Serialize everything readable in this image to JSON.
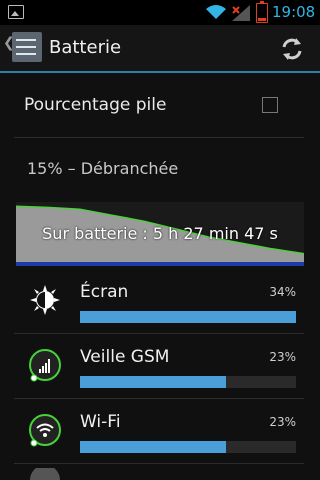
{
  "status_bar": {
    "time": "19:08"
  },
  "action_bar": {
    "title": "Batterie",
    "back_glyph": "❮"
  },
  "settings": {
    "percentage_label": "Pourcentage pile",
    "percentage_checked": false
  },
  "battery": {
    "status": "15% – Débranchée",
    "graph_label": "Sur batterie : 5 h 27 min 47 s",
    "graph_level": [
      0.93,
      0.91,
      0.88,
      0.78,
      0.68,
      0.55,
      0.42,
      0.32,
      0.22,
      0.14
    ]
  },
  "usage": [
    {
      "name": "Écran",
      "percent_label": "34%",
      "fraction": 1.0,
      "icon": "brightness-icon"
    },
    {
      "name": "Veille GSM",
      "percent_label": "23%",
      "fraction": 0.676,
      "icon": "cell-signal-icon"
    },
    {
      "name": "Wi-Fi",
      "percent_label": "23%",
      "fraction": 0.676,
      "icon": "wifi-icon"
    }
  ],
  "colors": {
    "accent": "#33b5e5",
    "bar": "#4a9fd8",
    "graph_line": "#4cd13a",
    "graph_fill": "#9a9a9a"
  }
}
